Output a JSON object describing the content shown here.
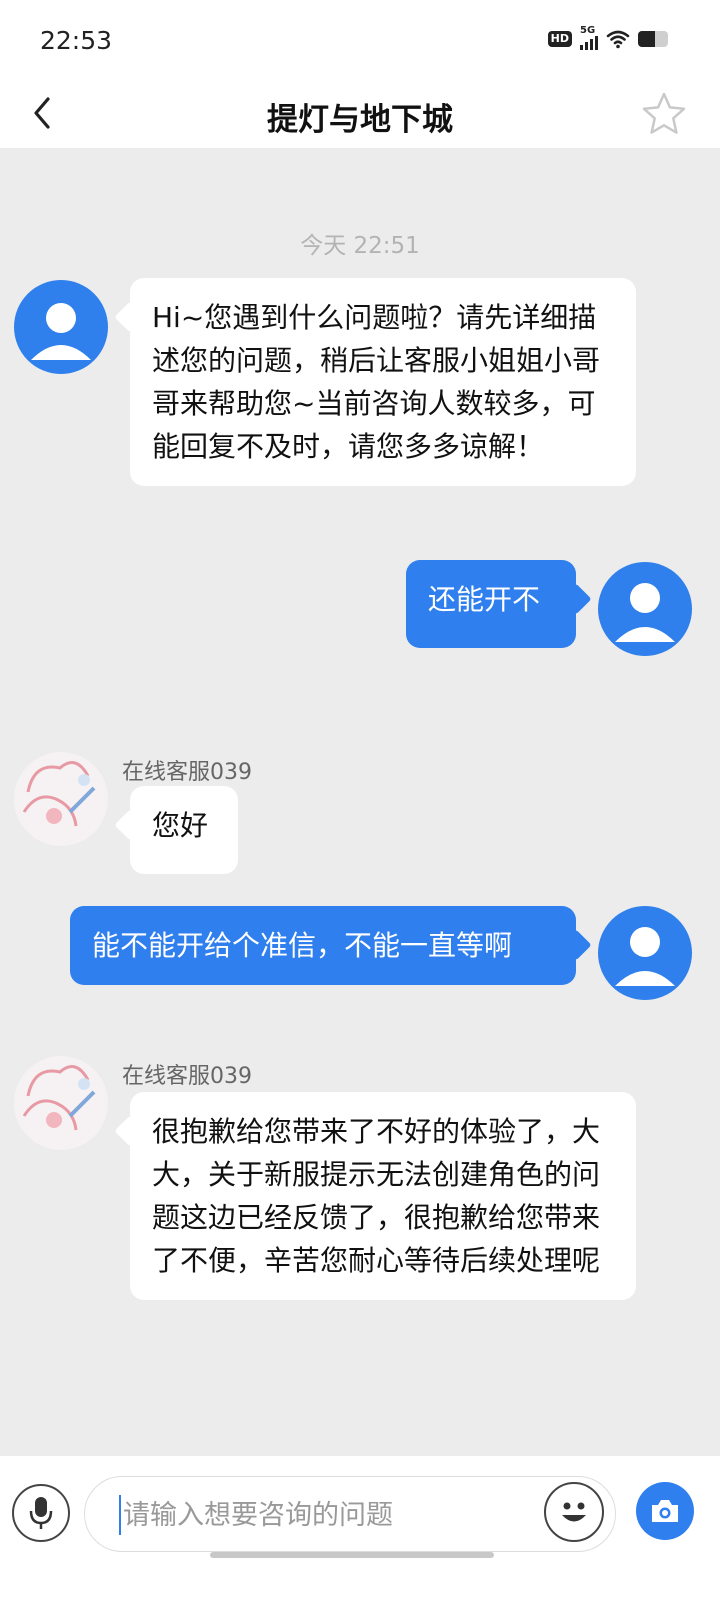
{
  "status_bar": {
    "time": "22:53",
    "hd_label": "HD",
    "network_label": "5G",
    "battery_level": 0.55
  },
  "header": {
    "title": "提灯与地下城",
    "back_icon": "chevron-left-icon",
    "favorite_icon": "star-outline-icon"
  },
  "chat": {
    "timestamp": "今天 22:51",
    "messages": [
      {
        "side": "left",
        "sender": "bot",
        "text": "Hi~您遇到什么问题啦？请先详细描述您的问题，稍后让客服小姐姐小哥哥来帮助您~当前咨询人数较多，可能回复不及时，请您多多谅解！"
      },
      {
        "side": "right",
        "sender": "user",
        "text": "还能开不"
      },
      {
        "side": "left",
        "sender": "agent",
        "name": "在线客服039",
        "text": "您好"
      },
      {
        "side": "right",
        "sender": "user",
        "text": "能不能开给个准信，不能一直等啊"
      },
      {
        "side": "left",
        "sender": "agent",
        "name": "在线客服039",
        "text": "很抱歉给您带来了不好的体验了，大大，关于新服提示无法创建角色的问题这边已经反馈了，很抱歉给您带来了不便，辛苦您耐心等待后续处理呢"
      }
    ]
  },
  "input_bar": {
    "placeholder": "请输入想要咨询的问题",
    "value": "",
    "mic_icon": "microphone-icon",
    "emoji_icon": "emoji-icon",
    "camera_icon": "camera-icon"
  },
  "colors": {
    "accent": "#2f7fee",
    "chat_bg": "#ececec"
  }
}
